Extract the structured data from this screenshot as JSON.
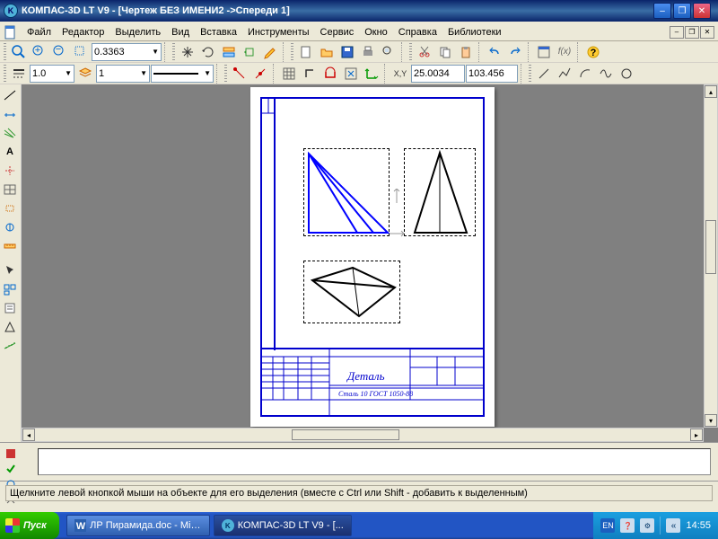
{
  "title": "КОМПАС-3D LT V9 - [Чертеж БЕЗ ИМЕНИ2 ->Спереди 1]",
  "menu": {
    "file": "Файл",
    "edit": "Редактор",
    "select": "Выделить",
    "view": "Вид",
    "insert": "Вставка",
    "tools": "Инструменты",
    "service": "Сервис",
    "window": "Окно",
    "help": "Справка",
    "libs": "Библиотеки"
  },
  "toolbar1": {
    "zoom": "0.3363"
  },
  "toolbar2": {
    "v1": "1.0",
    "v2": "1",
    "coord_x": "25.0034",
    "coord_y": "103.456"
  },
  "stamp": {
    "title": "Деталь",
    "material": "Сталь 10 ГОСТ 1050-88"
  },
  "hint": "Щелкните левой кнопкой мыши на объекте для его выделения (вместе с Ctrl или Shift - добавить к выделенным)",
  "taskbar": {
    "start": "Пуск",
    "t1": "ЛР Пирамида.doc - Micr...",
    "t2": "КОМПАС-3D LT V9 - [...",
    "lang": "EN",
    "clock": "14:55"
  }
}
